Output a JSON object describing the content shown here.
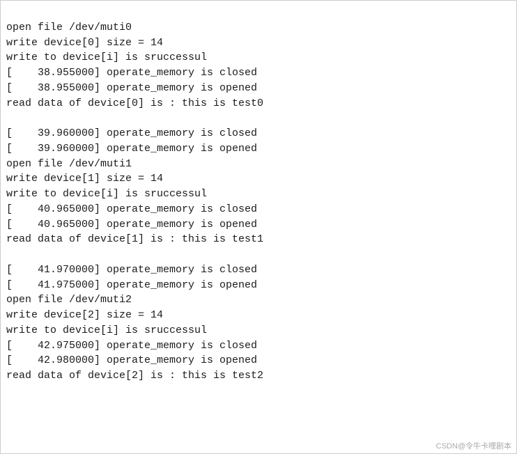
{
  "terminal": {
    "lines": [
      "open file /dev/muti0",
      "write device[0] size = 14",
      "write to device[i] is sruccessul",
      "[    38.955000] operate_memory is closed",
      "[    38.955000] operate_memory is opened",
      "read data of device[0] is : this is test0",
      "",
      "[    39.960000] operate_memory is closed",
      "[    39.960000] operate_memory is opened",
      "open file /dev/muti1",
      "write device[1] size = 14",
      "write to device[i] is sruccessul",
      "[    40.965000] operate_memory is closed",
      "[    40.965000] operate_memory is opened",
      "read data of device[1] is : this is test1",
      "",
      "[    41.970000] operate_memory is closed",
      "[    41.975000] operate_memory is opened",
      "open file /dev/muti2",
      "write device[2] size = 14",
      "write to device[i] is sruccessul",
      "[    42.975000] operate_memory is closed",
      "[    42.980000] operate_memory is opened",
      "read data of device[2] is : this is test2"
    ],
    "watermark": "CSDN@令牛卡哩剧本"
  }
}
